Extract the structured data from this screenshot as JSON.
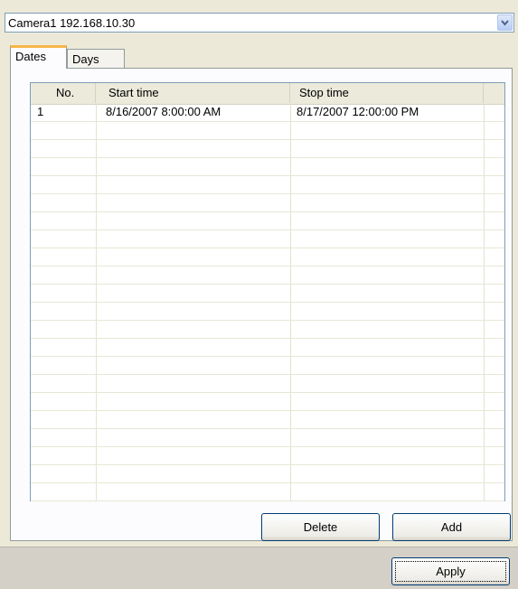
{
  "camera_select": {
    "value": "Camera1 192.168.10.30",
    "icon": "chevron-down-icon"
  },
  "tabs": [
    {
      "label": "Dates",
      "active": true
    },
    {
      "label": "Days",
      "active": false
    }
  ],
  "schedule_table": {
    "columns": [
      "No.",
      "Start time",
      "Stop time"
    ],
    "rows": [
      {
        "no": "1",
        "start": "8/16/2007 8:00:00 AM",
        "stop": "8/17/2007 12:00:00 PM"
      }
    ]
  },
  "buttons": {
    "delete": "Delete",
    "add": "Add",
    "apply": "Apply"
  },
  "colors": {
    "active_tab_accent": "#f7b74a",
    "window_bg": "#ece9d8",
    "border": "#7f9db9"
  }
}
